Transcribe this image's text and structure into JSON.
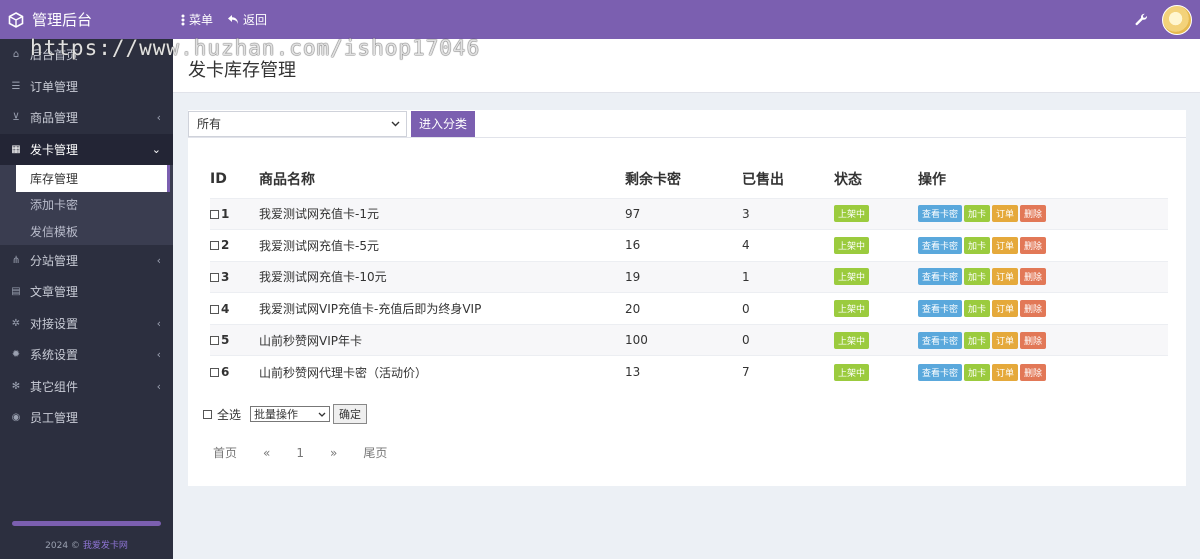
{
  "header": {
    "brand": "管理后台",
    "menu_label": "菜单",
    "back_label": "返回"
  },
  "watermark": "https://www.huzhan.com/ishop17046",
  "sidebar": {
    "items": [
      {
        "label": "后台首页"
      },
      {
        "label": "订单管理"
      },
      {
        "label": "商品管理"
      },
      {
        "label": "发卡管理"
      },
      {
        "label": "分站管理"
      },
      {
        "label": "文章管理"
      },
      {
        "label": "对接设置"
      },
      {
        "label": "系统设置"
      },
      {
        "label": "其它组件"
      },
      {
        "label": "员工管理"
      }
    ],
    "submenu": [
      "库存管理",
      "添加卡密",
      "发信模板"
    ],
    "footer_year": "2024 ©",
    "footer_link": "我爱发卡网"
  },
  "page": {
    "title": "发卡库存管理",
    "category_selected": "所有",
    "enter_button": "进入分类"
  },
  "table": {
    "headers": [
      "ID",
      "商品名称",
      "剩余卡密",
      "已售出",
      "状态",
      "操作"
    ],
    "rows": [
      {
        "id": "1",
        "name": "我爱测试网充值卡-1元",
        "remaining": "97",
        "sold": "3",
        "status": "上架中"
      },
      {
        "id": "2",
        "name": "我爱测试网充值卡-5元",
        "remaining": "16",
        "sold": "4",
        "status": "上架中"
      },
      {
        "id": "3",
        "name": "我爱测试网充值卡-10元",
        "remaining": "19",
        "sold": "1",
        "status": "上架中"
      },
      {
        "id": "4",
        "name": "我爱测试网VIP充值卡-充值后即为终身VIP",
        "remaining": "20",
        "sold": "0",
        "status": "上架中"
      },
      {
        "id": "5",
        "name": "山前秒赞网VIP年卡",
        "remaining": "100",
        "sold": "0",
        "status": "上架中"
      },
      {
        "id": "6",
        "name": "山前秒赞网代理卡密（活动价）",
        "remaining": "13",
        "sold": "7",
        "status": "上架中"
      }
    ],
    "ops": {
      "view": "查看卡密",
      "add": "加卡",
      "order": "订单",
      "del": "删除"
    }
  },
  "batch": {
    "select_all": "全选",
    "batch_select": "批量操作",
    "confirm": "确定"
  },
  "pager": {
    "first": "首页",
    "prev": "«",
    "current": "1",
    "next": "»",
    "last": "尾页"
  }
}
